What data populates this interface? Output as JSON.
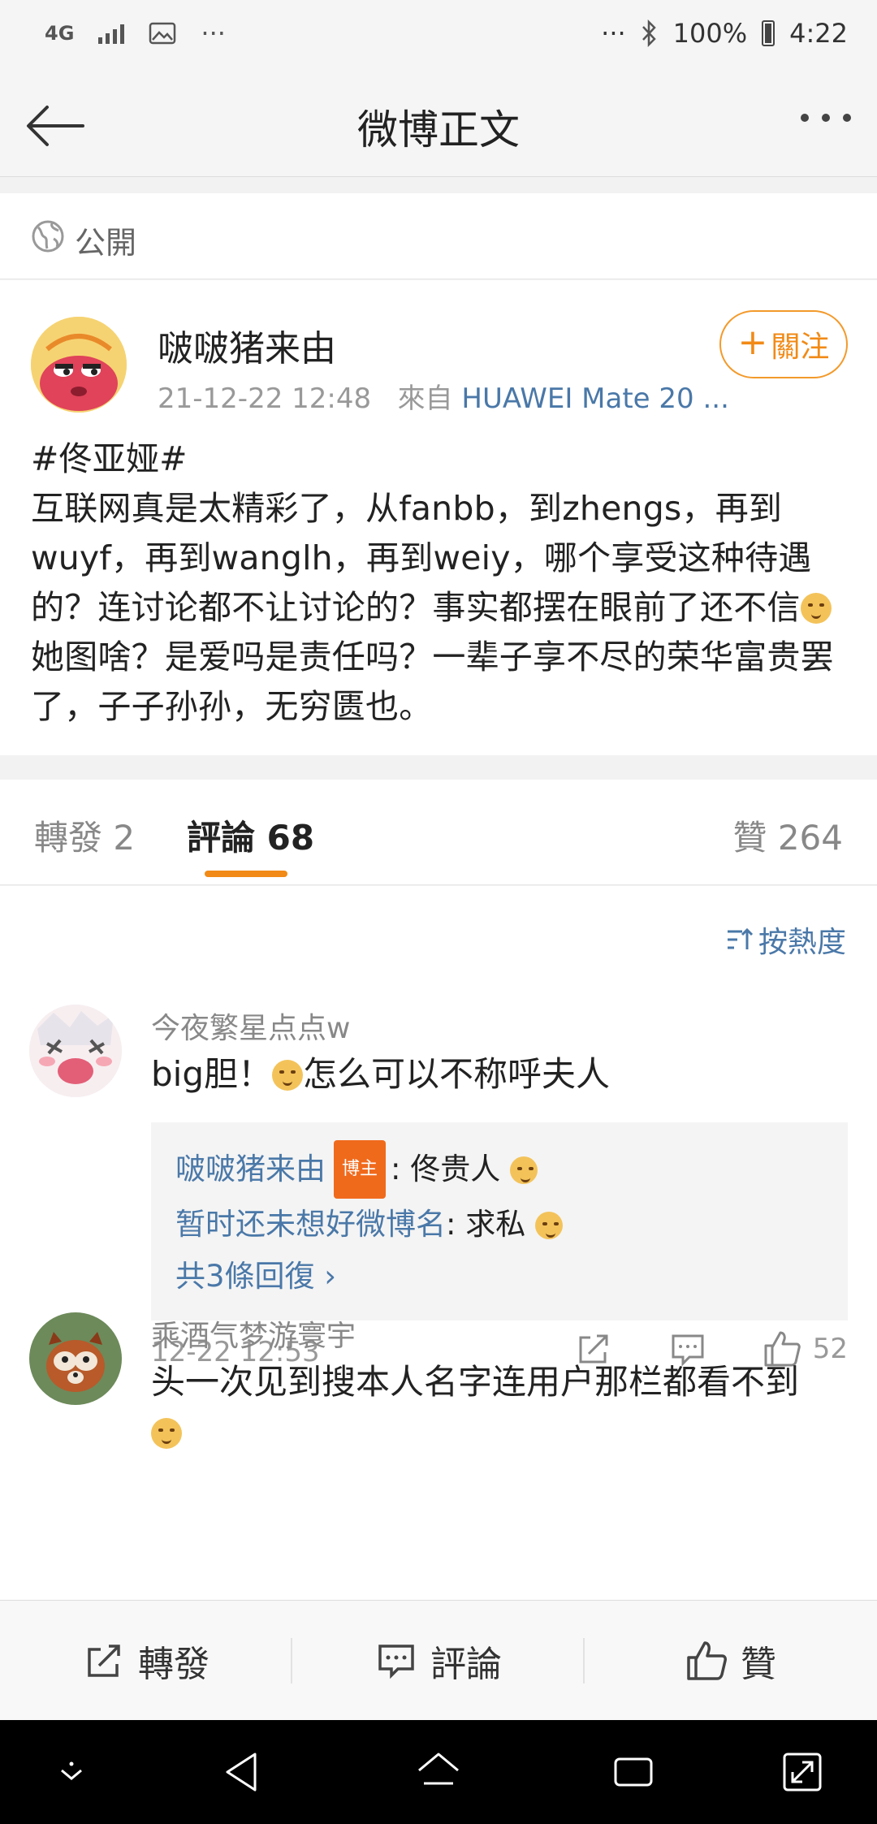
{
  "status_bar": {
    "network": "4G",
    "more": "···",
    "more_right": "···",
    "battery": "100%",
    "time": "4:22"
  },
  "nav": {
    "title": "微博正文"
  },
  "visibility": {
    "label": "公開"
  },
  "post": {
    "author": "啵啵猪来由",
    "time": "21-12-22 12:48",
    "source_prefix": "來自",
    "source": "HUAWEI Mate 20 ...",
    "follow_label": "關注",
    "hashtag": "#佟亚娅#",
    "text_part1": "互联网真是太精彩了，从fanbb，到zhengs，再到wuyf，再到wanglh，再到weiy，哪个享受这种待遇的？连讨论都不让讨论的？事实都摆在眼前了还不信",
    "text_part2": "她图啥？是爱吗是责任吗？一辈子享不尽的荣华富贵罢了，子子孙孙，无穷匮也。"
  },
  "tabs": {
    "reposts": "轉發 2",
    "comments": "評論 68",
    "likes": "贊 264"
  },
  "sort": {
    "label": "按熱度"
  },
  "comments": [
    {
      "name": "今夜繁星点点w",
      "text_before": "big胆！",
      "text_after": "怎么可以不称呼夫人",
      "replies": [
        {
          "name": "啵啵猪来由",
          "badge": "博主",
          "text": ": 佟贵人"
        },
        {
          "name": "暂时还未想好微博名",
          "text": ": 求私"
        }
      ],
      "more_replies": "共3條回復 ›",
      "time": "12-22 12:53",
      "likes": "52"
    },
    {
      "name": "乘酒气梦游寰宇",
      "text": "头一次见到搜本人名字连用户那栏都看不到"
    }
  ],
  "bottom_bar": {
    "repost": "轉發",
    "comment": "評論",
    "like": "贊"
  },
  "colors": {
    "accent_orange": "#f18a16",
    "link_blue": "#4a78a8",
    "badge_orange": "#f06a1c"
  }
}
